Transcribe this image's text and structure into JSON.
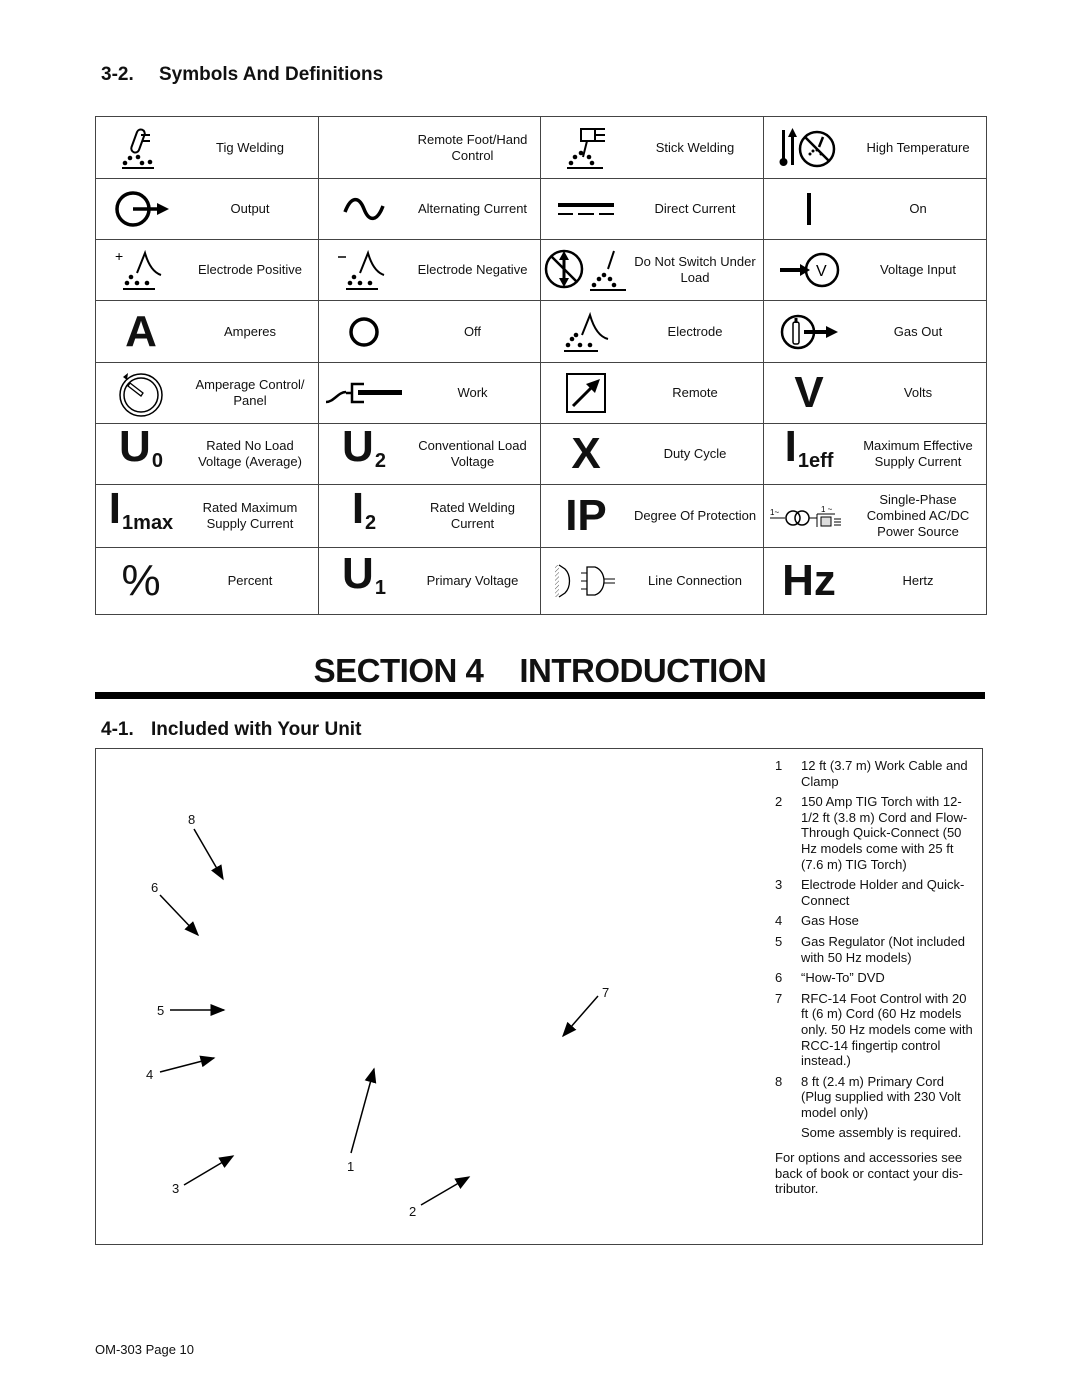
{
  "section_3_2": {
    "number": "3-2.",
    "title": "Symbols And Definitions",
    "symbols": [
      [
        {
          "icon": "tig-welding-icon",
          "label": "Tig Welding"
        },
        {
          "icon": "remote-foot-hand-control-icon",
          "label": "Remote Foot/Hand Control"
        },
        {
          "icon": "stick-welding-icon",
          "label": "Stick Welding"
        },
        {
          "icon": "high-temperature-icon",
          "label": "High Temperature"
        }
      ],
      [
        {
          "icon": "output-icon",
          "label": "Output"
        },
        {
          "icon": "alternating-current-icon",
          "label": "Alternating Current"
        },
        {
          "icon": "direct-current-icon",
          "label": "Direct Current"
        },
        {
          "icon": "on-icon",
          "label": "On"
        }
      ],
      [
        {
          "icon": "electrode-positive-icon",
          "label": "Electrode Positive"
        },
        {
          "icon": "electrode-negative-icon",
          "label": "Electrode Negative"
        },
        {
          "icon": "do-not-switch-under-load-icon",
          "label": "Do Not Switch Under Load"
        },
        {
          "icon": "voltage-input-icon",
          "label": "Voltage Input"
        }
      ],
      [
        {
          "icon": "amperes-icon",
          "glyph": "A",
          "label": "Amperes"
        },
        {
          "icon": "off-icon",
          "label": "Off"
        },
        {
          "icon": "electrode-icon",
          "label": "Electrode"
        },
        {
          "icon": "gas-out-icon",
          "label": "Gas Out"
        }
      ],
      [
        {
          "icon": "amperage-control-panel-icon",
          "label": "Amperage Control/ Panel"
        },
        {
          "icon": "work-icon",
          "label": "Work"
        },
        {
          "icon": "remote-icon",
          "label": "Remote"
        },
        {
          "icon": "volts-icon",
          "glyph": "V",
          "label": "Volts"
        }
      ],
      [
        {
          "icon": "rated-no-load-voltage-icon",
          "glyph": "U",
          "sub": "0",
          "label": "Rated No Load Voltage (Average)"
        },
        {
          "icon": "conventional-load-voltage-icon",
          "glyph": "U",
          "sub": "2",
          "label": "Conventional Load Voltage"
        },
        {
          "icon": "duty-cycle-icon",
          "glyph": "X",
          "label": "Duty Cycle"
        },
        {
          "icon": "max-effective-supply-current-icon",
          "glyph": "I",
          "sub": "1eff",
          "label": "Maximum Effective Supply Current"
        }
      ],
      [
        {
          "icon": "rated-max-supply-current-icon",
          "glyph": "I",
          "sub": "1max",
          "label": "Rated Maximum Supply Current"
        },
        {
          "icon": "rated-welding-current-icon",
          "glyph": "I",
          "sub": "2",
          "label": "Rated Welding Current"
        },
        {
          "icon": "degree-of-protection-icon",
          "glyph": "IP",
          "label": "Degree Of Protection"
        },
        {
          "icon": "single-phase-ac-dc-power-source-icon",
          "label": "Single-Phase Combined AC/DC Power Source"
        }
      ],
      [
        {
          "icon": "percent-icon",
          "glyph": "%",
          "label": "Percent"
        },
        {
          "icon": "primary-voltage-icon",
          "glyph": "U",
          "sub": "1",
          "label": "Primary Voltage"
        },
        {
          "icon": "line-connection-icon",
          "label": "Line Connection"
        },
        {
          "icon": "hertz-icon",
          "glyph": "Hz",
          "label": "Hertz"
        }
      ]
    ]
  },
  "section_4": {
    "title_left": "SECTION 4",
    "title_right": "INTRODUCTION"
  },
  "section_4_1": {
    "number": "4-1.",
    "title": "Included with Your Unit",
    "callouts": [
      "1",
      "2",
      "3",
      "4",
      "5",
      "6",
      "7",
      "8"
    ],
    "items": [
      {
        "n": "1",
        "text": "12 ft (3.7 m) Work Cable and Clamp"
      },
      {
        "n": "2",
        "text": "150 Amp TIG Torch with 12-1/2 ft (3.8 m) Cord and Flow-Through Quick-Connect (50 Hz models come with 25 ft (7.6 m) TIG Torch)"
      },
      {
        "n": "3",
        "text": "Electrode Holder and Quick-Connect"
      },
      {
        "n": "4",
        "text": "Gas Hose"
      },
      {
        "n": "5",
        "text": "Gas Regulator (Not included with 50 Hz models)"
      },
      {
        "n": "6",
        "text": "“How-To” DVD"
      },
      {
        "n": "7",
        "text": "RFC-14 Foot Control with 20 ft (6 m) Cord (60 Hz models only. 50 Hz models come with RCC-14 fingertip control instead.)"
      },
      {
        "n": "8",
        "text": "8 ft (2.4 m) Primary Cord (Plug supplied with 230 Volt model only)"
      }
    ],
    "assembly_note": "Some assembly is required.",
    "accessories_note": "For options and accessories see back of book or contact your dis-tributor."
  },
  "footer": {
    "page_label": "OM-303 Page 10"
  }
}
